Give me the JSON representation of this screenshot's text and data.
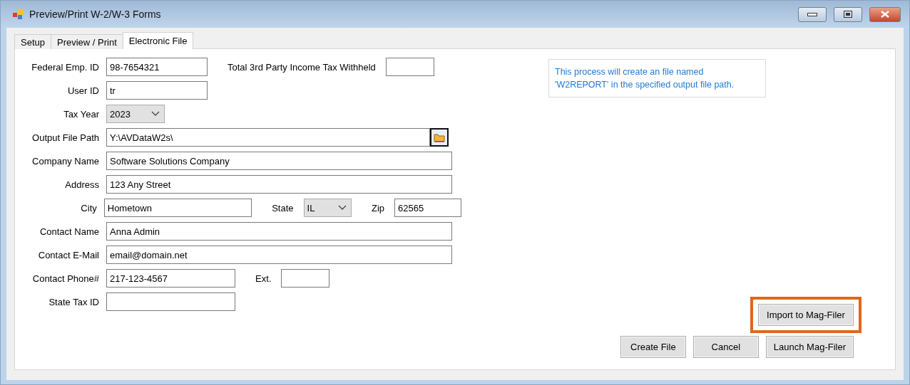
{
  "window": {
    "title": "Preview/Print W-2/W-3 Forms"
  },
  "tabs": [
    {
      "label": "Setup",
      "selected": false
    },
    {
      "label": "Preview / Print",
      "selected": false
    },
    {
      "label": "Electronic File",
      "selected": true
    }
  ],
  "form": [
    {
      "label": "Federal Emp. ID",
      "items": [
        {
          "kind": "short",
          "value": "98-7654321"
        },
        {
          "kind": "label",
          "text": "Total 3rd Party Income Tax Withheld"
        },
        {
          "kind": "tiny",
          "value": ""
        }
      ]
    },
    {
      "label": "User ID",
      "items": [
        {
          "kind": "short",
          "value": "tr"
        }
      ]
    },
    {
      "label": "Tax Year",
      "items": [
        {
          "kind": "select",
          "value": "2023"
        }
      ]
    },
    {
      "label": "Output File Path",
      "items": [
        {
          "kind": "path",
          "value": "Y:\\AVDataW2s\\"
        }
      ]
    },
    {
      "label": "Company Name",
      "items": [
        {
          "kind": "wide",
          "value": "Software Solutions Company"
        }
      ]
    },
    {
      "label": "Address",
      "items": [
        {
          "kind": "wide",
          "value": "123 Any Street"
        }
      ]
    },
    {
      "label": "City",
      "items": [
        {
          "kind": "city",
          "value": "Hometown"
        },
        {
          "kind": "label",
          "text": "State"
        },
        {
          "kind": "select",
          "value": "IL"
        },
        {
          "kind": "label",
          "text": "Zip"
        },
        {
          "kind": "zip",
          "value": "62565"
        }
      ]
    },
    {
      "label": "Contact Name",
      "items": [
        {
          "kind": "wide",
          "value": "Anna Admin"
        }
      ]
    },
    {
      "label": "Contact E-Mail",
      "items": [
        {
          "kind": "wide",
          "value": "email@domain.net"
        }
      ]
    },
    {
      "label": "Contact Phone#",
      "items": [
        {
          "kind": "medium",
          "value": "217-123-4567"
        },
        {
          "kind": "label",
          "text": "Ext."
        },
        {
          "kind": "tiny",
          "value": ""
        }
      ]
    },
    {
      "label": "State Tax ID",
      "items": [
        {
          "kind": "medium",
          "value": ""
        }
      ]
    }
  ],
  "info": "This process will create an file named 'W2REPORT'  in the specified output file path.",
  "import_button": {
    "label": "Import to Mag-Filer",
    "highlighted": true
  },
  "buttons": [
    "Create File",
    "Cancel",
    "Launch Mag-Filer"
  ]
}
